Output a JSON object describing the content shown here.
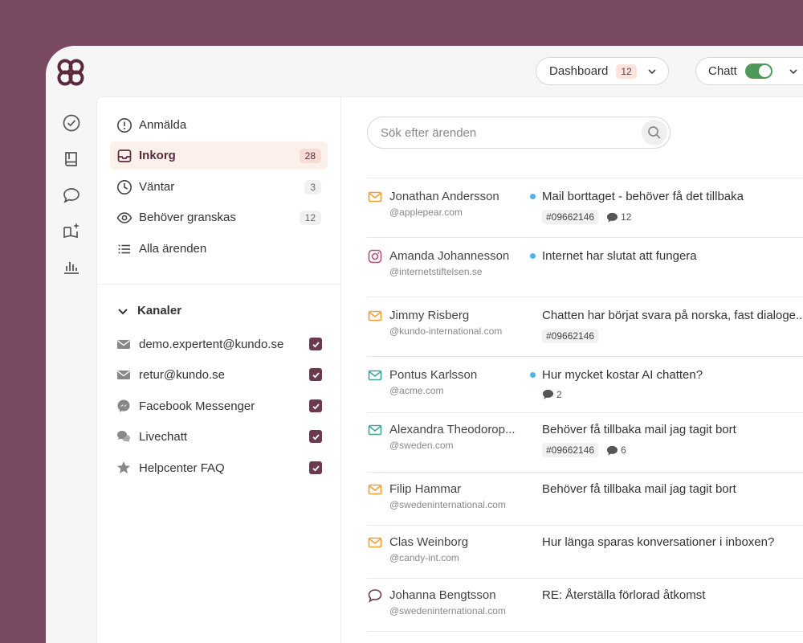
{
  "colors": {
    "background": "#7a4a62",
    "brand": "#5a2a3e",
    "checkbox": "#6b3a4c",
    "toggle_on": "#4c9a5a",
    "unread_dot": "#4fb3e8",
    "mail_orange": "#f0a030",
    "mail_teal": "#3aa59a",
    "instagram": "#b0507a"
  },
  "topbar": {
    "logo_icon": "kundo-logo-icon",
    "dashboard": {
      "label": "Dashboard",
      "count": "12"
    },
    "chat": {
      "label": "Chatt",
      "enabled": true
    }
  },
  "rail": {
    "icons": [
      "check-circle-icon",
      "book-icon",
      "chat-bubble-icon",
      "sparkle-book-icon",
      "bar-chart-icon"
    ]
  },
  "nav": {
    "items": [
      {
        "label": "Anmälda",
        "icon": "alert-circle-icon",
        "count": ""
      },
      {
        "label": "Inkorg",
        "icon": "inbox-icon",
        "count": "28",
        "active": true
      },
      {
        "label": "Väntar",
        "icon": "clock-icon",
        "count": "3"
      },
      {
        "label": "Behöver granskas",
        "icon": "eye-icon",
        "count": "12"
      },
      {
        "label": "Alla ärenden",
        "icon": "list-icon",
        "count": ""
      }
    ]
  },
  "channels": {
    "title": "Kanaler",
    "items": [
      {
        "label": "demo.expertent@kundo.se",
        "icon": "envelope-icon",
        "checked": true
      },
      {
        "label": "retur@kundo.se",
        "icon": "envelope-icon",
        "checked": true
      },
      {
        "label": "Facebook Messenger",
        "icon": "messenger-icon",
        "checked": true
      },
      {
        "label": "Livechatt",
        "icon": "livechat-icon",
        "checked": true
      },
      {
        "label": "Helpcenter FAQ",
        "icon": "star-icon",
        "checked": true
      }
    ]
  },
  "search": {
    "placeholder": "Sök efter ärenden"
  },
  "tickets": [
    {
      "name": "Jonathan Andersson",
      "email": "@applepear.com",
      "subject": "Mail borttaget - behöver få det tillbaka",
      "unread": true,
      "tag": "#09662146",
      "messages": "12",
      "icon": "mail-icon"
    },
    {
      "name": "Amanda Johannesson",
      "email": "@internetstiftelsen.se",
      "subject": "Internet har slutat att fungera",
      "unread": true,
      "tag": "",
      "messages": "",
      "icon": "instagram-icon"
    },
    {
      "name": "Jimmy Risberg",
      "email": "@kundo-international.com",
      "subject": "Chatten har börjat svara på norska, fast dialoge...",
      "unread": false,
      "tag": "#09662146",
      "messages": "",
      "icon": "mail-icon"
    },
    {
      "name": "Pontus Karlsson",
      "email": "@acme.com",
      "subject": "Hur mycket kostar AI chatten?",
      "unread": true,
      "tag": "",
      "messages": "2",
      "icon": "mail-teal-icon"
    },
    {
      "name": "Alexandra Theodorop...",
      "email": "@sweden.com",
      "subject": "Behöver få tillbaka mail jag tagit bort",
      "unread": false,
      "tag": "#09662146",
      "messages": "6",
      "icon": "mail-teal-icon"
    },
    {
      "name": "Filip Hammar",
      "email": "@swedeninternational.com",
      "subject": "Behöver få tillbaka mail jag tagit bort",
      "unread": false,
      "tag": "",
      "messages": "",
      "icon": "mail-icon"
    },
    {
      "name": "Clas Weinborg",
      "email": "@candy-int.com",
      "subject": "Hur länga sparas konversationer i inboxen?",
      "unread": false,
      "tag": "",
      "messages": "",
      "icon": "mail-icon"
    },
    {
      "name": "Johanna Bengtsson",
      "email": "@swedeninternational.com",
      "subject": "RE: Återställa förlorad åtkomst",
      "unread": false,
      "tag": "",
      "messages": "",
      "icon": "chat-bubble-icon"
    }
  ]
}
